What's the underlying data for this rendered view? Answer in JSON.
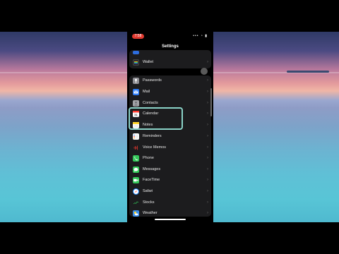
{
  "status_bar": {
    "time": "7:58",
    "signal": "••• ◔ ▮"
  },
  "settings": {
    "title": "Settings",
    "items": [
      {
        "label": "",
        "icon": "partial-icon",
        "color": "#2d6dde",
        "chevron": "›"
      },
      {
        "label": "Wallet",
        "icon": "wallet-icon",
        "color": "#2b2b2b",
        "chevron": "›"
      },
      {
        "label": "Passwords",
        "icon": "key-icon",
        "color": "#8e8e93",
        "chevron": "›"
      },
      {
        "label": "Mail",
        "icon": "mail-icon",
        "color": "#2e7cf6",
        "chevron": "›"
      },
      {
        "label": "Contacts",
        "icon": "contacts-icon",
        "color": "#a2a2a7",
        "chevron": "›"
      },
      {
        "label": "Calendar",
        "icon": "calendar-icon",
        "color": "#ffffff",
        "chevron": "›"
      },
      {
        "label": "Notes",
        "icon": "notes-icon",
        "color": "#ffd52e",
        "chevron": "›"
      },
      {
        "label": "Reminders",
        "icon": "reminders-icon",
        "color": "#ffffff",
        "chevron": "›"
      },
      {
        "label": "Voice Memos",
        "icon": "voice-memos-icon",
        "color": "#1c1c1e",
        "chevron": "›"
      },
      {
        "label": "Phone",
        "icon": "phone-icon",
        "color": "#34c759",
        "chevron": "›"
      },
      {
        "label": "Messages",
        "icon": "messages-icon",
        "color": "#34c759",
        "chevron": "›"
      },
      {
        "label": "FaceTime",
        "icon": "facetime-icon",
        "color": "#34c759",
        "chevron": "›"
      },
      {
        "label": "Safari",
        "icon": "safari-icon",
        "color": "#1a82f7",
        "chevron": "›"
      },
      {
        "label": "Stocks",
        "icon": "stocks-icon",
        "color": "#1c1c1e",
        "chevron": "›"
      },
      {
        "label": "Weather",
        "icon": "weather-icon",
        "color": "#3b8ee8",
        "chevron": "›"
      }
    ]
  }
}
